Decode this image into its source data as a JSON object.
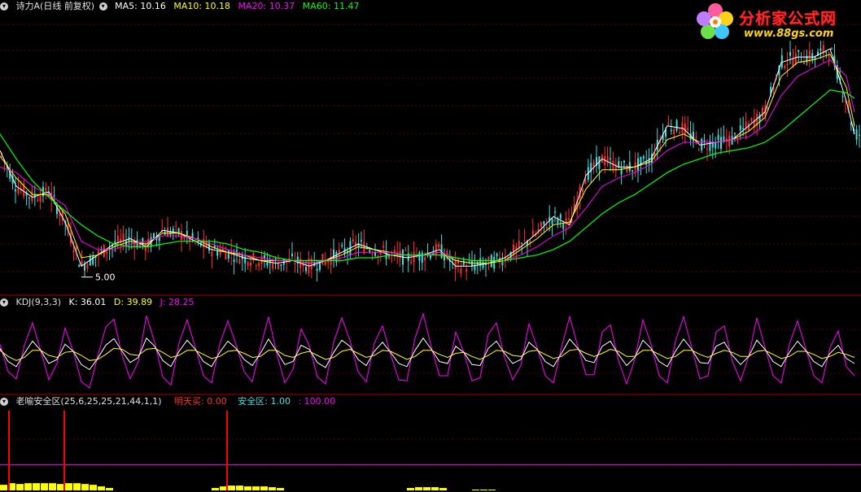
{
  "colors": {
    "background": "#000000",
    "separator": "#b00000",
    "grid": "#5a0000",
    "up": "#ff3030",
    "down": "#40e0e0",
    "ma5": "#ffffff",
    "ma10": "#ffff00",
    "ma20": "#ff00ff",
    "ma60": "#00ff00",
    "k": "#ffffff",
    "d": "#ffff00",
    "j": "#ff00ff",
    "buy_label": "#ff3030",
    "safe_label": "#40e0e0",
    "buy_bar": "#ff0000",
    "safe_line": "#ff00ff",
    "safe_fill": "#ffff00"
  },
  "price_panel": {
    "title": "诗力A(日线 前复权)",
    "indicators": [
      {
        "label": "MA5: 10.16",
        "color": "#ffffff"
      },
      {
        "label": "MA10: 10.18",
        "color": "#ffff00"
      },
      {
        "label": "MA20: 10.37",
        "color": "#ff00ff"
      },
      {
        "label": "MA60: 11.47",
        "color": "#00ff00"
      }
    ],
    "min_marker": "5.00"
  },
  "kdj_panel": {
    "name": "KDJ(9,3,3)",
    "k_label": "K: 36.01",
    "d_label": "D: 39.89",
    "j_label": "J: 28.25"
  },
  "safe_panel": {
    "name": "老喻安全区(25,6,25,25,21,44,1,1)",
    "buy_label": "明天买: 0.00",
    "safe_label": "安全区: 1.00",
    "extra_label": ": 100.00"
  },
  "logo": {
    "brand": "分析家公式网",
    "url": "www.88gs.com"
  },
  "chart_data": [
    {
      "type": "line",
      "title": "诗力A(日线 前复权)",
      "x": [
        0,
        20,
        40,
        60,
        80,
        100,
        120,
        140,
        160,
        180,
        200,
        220,
        240,
        260,
        280,
        300,
        320,
        340,
        360,
        380,
        400,
        420,
        440,
        460,
        480,
        500,
        520,
        540,
        560,
        580,
        600,
        620,
        640,
        660,
        680,
        700,
        720,
        740,
        760,
        780,
        800,
        820,
        840,
        860,
        880,
        900,
        920,
        940,
        960,
        980,
        1000,
        1020,
        1040,
        1050
      ],
      "series": [
        {
          "name": "MA5",
          "values": [
            9.6,
            8.3,
            7.9,
            8.1,
            7.0,
            5.4,
            5.8,
            6.2,
            6.4,
            6.1,
            6.7,
            6.6,
            6.3,
            6.0,
            5.9,
            5.7,
            5.6,
            5.5,
            5.6,
            5.4,
            5.6,
            5.9,
            6.2,
            6.0,
            5.8,
            5.7,
            5.8,
            6.0,
            5.4,
            5.4,
            5.5,
            5.7,
            6.1,
            6.6,
            7.2,
            6.9,
            8.7,
            9.3,
            9.0,
            9.0,
            9.3,
            10.5,
            10.4,
            9.8,
            9.9,
            10.0,
            10.5,
            11.0,
            12.8,
            13.0,
            13.0,
            13.3,
            11.4,
            10.2
          ]
        },
        {
          "name": "MA10",
          "values": [
            9.4,
            8.6,
            8.0,
            8.0,
            7.3,
            5.7,
            5.8,
            6.1,
            6.3,
            6.2,
            6.6,
            6.6,
            6.4,
            6.1,
            5.9,
            5.8,
            5.6,
            5.6,
            5.6,
            5.5,
            5.6,
            5.8,
            6.1,
            6.0,
            5.9,
            5.8,
            5.8,
            5.9,
            5.6,
            5.5,
            5.5,
            5.6,
            6.0,
            6.4,
            6.9,
            7.0,
            8.2,
            8.9,
            8.9,
            9.0,
            9.2,
            10.0,
            10.2,
            9.9,
            9.9,
            10.0,
            10.3,
            10.8,
            12.3,
            12.8,
            12.9,
            13.1,
            11.9,
            10.5
          ]
        },
        {
          "name": "MA20",
          "values": [
            9.0,
            8.8,
            8.3,
            8.0,
            7.6,
            6.3,
            6.0,
            6.0,
            6.2,
            6.3,
            6.5,
            6.5,
            6.4,
            6.2,
            6.0,
            5.8,
            5.7,
            5.6,
            5.6,
            5.5,
            5.6,
            5.7,
            5.9,
            5.9,
            5.9,
            5.8,
            5.8,
            5.9,
            5.7,
            5.6,
            5.6,
            5.6,
            5.8,
            6.1,
            6.5,
            6.8,
            7.5,
            8.3,
            8.6,
            8.8,
            9.1,
            9.6,
            9.9,
            9.9,
            9.9,
            10.0,
            10.1,
            10.5,
            11.6,
            12.3,
            12.6,
            12.9,
            12.3,
            11.0
          ]
        },
        {
          "name": "MA60",
          "values": [
            10.2,
            9.3,
            8.5,
            7.9,
            7.4,
            6.9,
            6.5,
            6.2,
            6.1,
            6.1,
            6.2,
            6.3,
            6.3,
            6.3,
            6.2,
            6.0,
            5.9,
            5.7,
            5.6,
            5.6,
            5.6,
            5.6,
            5.7,
            5.7,
            5.8,
            5.8,
            5.8,
            5.8,
            5.7,
            5.6,
            5.6,
            5.6,
            5.7,
            5.8,
            6.0,
            6.3,
            6.8,
            7.3,
            7.7,
            8.0,
            8.4,
            8.8,
            9.1,
            9.3,
            9.5,
            9.6,
            9.7,
            9.9,
            10.3,
            10.8,
            11.3,
            11.8,
            11.7,
            11.5
          ]
        }
      ],
      "ylim": [
        4.4,
        14.6
      ]
    },
    {
      "type": "line",
      "title": "KDJ(9,3,3)",
      "x": [
        0,
        10,
        20,
        30,
        40,
        50,
        60,
        70,
        80,
        90,
        100,
        110,
        120,
        130,
        140,
        150,
        160,
        170,
        180,
        190,
        200,
        210,
        220,
        230,
        240,
        250,
        260,
        270,
        280,
        290,
        300,
        310,
        320,
        330,
        340,
        350,
        360,
        370,
        380,
        390,
        400,
        410,
        420,
        430,
        440,
        450,
        460,
        470,
        480,
        490,
        500,
        510,
        520,
        530,
        540,
        550,
        560,
        570,
        580,
        590,
        600,
        610,
        620,
        630,
        640,
        650,
        660,
        670,
        680,
        690,
        700,
        710,
        720,
        730,
        740,
        750,
        760,
        770,
        780,
        790,
        800,
        810,
        820,
        830,
        840,
        850,
        860,
        870,
        880,
        890,
        900,
        910,
        920,
        930,
        940,
        950,
        960,
        970,
        980,
        990,
        1000,
        1010,
        1020,
        1030,
        1040,
        1050
      ],
      "series": [
        {
          "name": "K",
          "values": [
            66,
            40,
            30,
            56,
            80,
            62,
            36,
            44,
            74,
            60,
            34,
            24,
            46,
            72,
            85,
            60,
            38,
            48,
            86,
            70,
            42,
            30,
            60,
            82,
            64,
            40,
            30,
            58,
            80,
            66,
            44,
            32,
            56,
            84,
            60,
            34,
            40,
            72,
            64,
            38,
            28,
            58,
            82,
            70,
            44,
            32,
            60,
            78,
            58,
            36,
            30,
            62,
            86,
            64,
            40,
            36,
            70,
            58,
            34,
            32,
            66,
            80,
            56,
            36,
            44,
            78,
            64,
            40,
            30,
            56,
            84,
            66,
            42,
            38,
            70,
            80,
            54,
            32,
            48,
            82,
            66,
            40,
            30,
            60,
            84,
            64,
            38,
            36,
            70,
            78,
            52,
            34,
            50,
            82,
            64,
            40,
            30,
            58,
            80,
            62,
            40,
            30,
            56,
            72,
            46,
            36
          ]
        },
        {
          "name": "D",
          "values": [
            62,
            50,
            42,
            48,
            62,
            62,
            52,
            48,
            58,
            60,
            52,
            42,
            44,
            54,
            66,
            64,
            54,
            52,
            64,
            66,
            58,
            48,
            52,
            62,
            62,
            54,
            46,
            50,
            60,
            62,
            56,
            48,
            50,
            62,
            62,
            52,
            48,
            56,
            60,
            52,
            44,
            48,
            60,
            64,
            56,
            48,
            52,
            62,
            60,
            52,
            44,
            50,
            62,
            62,
            54,
            48,
            56,
            58,
            50,
            44,
            52,
            62,
            60,
            52,
            50,
            60,
            62,
            54,
            46,
            50,
            62,
            64,
            56,
            50,
            56,
            64,
            60,
            50,
            50,
            62,
            62,
            54,
            46,
            50,
            62,
            62,
            54,
            48,
            56,
            62,
            58,
            50,
            50,
            60,
            62,
            54,
            46,
            50,
            60,
            60,
            54,
            46,
            50,
            58,
            54,
            48
          ]
        },
        {
          "name": "J",
          "values": [
            74,
            20,
            6,
            72,
            116,
            62,
            4,
            36,
            106,
            60,
            0,
            -12,
            50,
            108,
            123,
            52,
            6,
            40,
            130,
            78,
            10,
            -6,
            76,
            122,
            68,
            12,
            -2,
            74,
            120,
            74,
            20,
            0,
            68,
            128,
            56,
            -2,
            24,
            104,
            72,
            10,
            -4,
            78,
            126,
            82,
            20,
            0,
            76,
            110,
            54,
            4,
            2,
            86,
            134,
            68,
            12,
            12,
            98,
            58,
            2,
            8,
            94,
            116,
            48,
            4,
            32,
            114,
            68,
            12,
            -2,
            68,
            128,
            70,
            14,
            14,
            98,
            112,
            42,
            -4,
            44,
            122,
            74,
            12,
            -2,
            80,
            128,
            68,
            6,
            12,
            98,
            110,
            40,
            2,
            50,
            126,
            68,
            12,
            -2,
            74,
            120,
            66,
            12,
            -2,
            68,
            100,
            30,
            12
          ]
        }
      ],
      "ylim": [
        -20,
        140
      ]
    },
    {
      "type": "bar",
      "title": "老喻安全区(25,6,25,25,21,44,1,1)",
      "series": [
        {
          "name": "明天买",
          "x": [
            10,
            78,
            278
          ],
          "values": [
            100,
            100,
            100
          ]
        },
        {
          "name": "安全区",
          "x": [
            0,
            10,
            20,
            30,
            40,
            50,
            60,
            70,
            80,
            90,
            100,
            110,
            120,
            130,
            260,
            270,
            280,
            290,
            300,
            310,
            320,
            330,
            340,
            500,
            510,
            520,
            530,
            540,
            580,
            590,
            600
          ],
          "values": [
            7,
            9,
            8,
            9,
            9,
            9,
            9,
            8,
            9,
            9,
            8,
            7,
            5,
            3,
            3,
            5,
            6,
            6,
            5,
            5,
            5,
            4,
            3,
            3,
            4,
            4,
            4,
            3,
            1,
            1,
            1
          ]
        }
      ],
      "ylim": [
        0,
        100
      ]
    }
  ]
}
